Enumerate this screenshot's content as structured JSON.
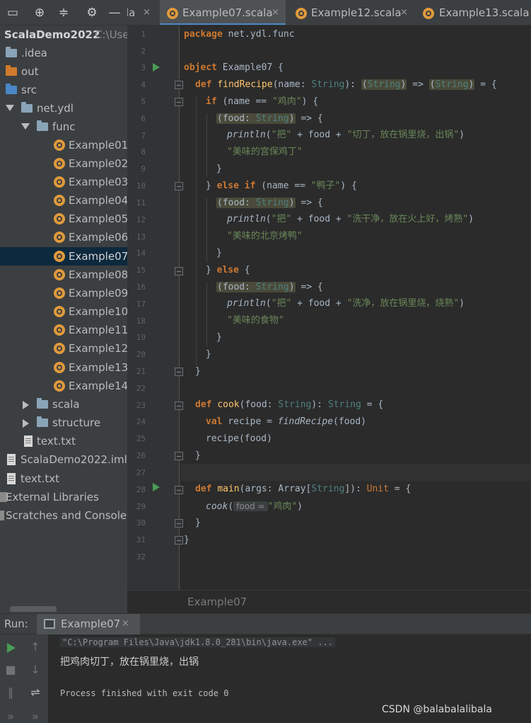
{
  "project_toolbar": {
    "icons": [
      "project-view-icon",
      "locate-icon",
      "collapse-icon",
      "gear-icon",
      "hide-icon"
    ]
  },
  "tree": {
    "root_name": "ScalaDemo2022",
    "root_path": "C:\\Use",
    "items": {
      "idea": ".idea",
      "out": "out",
      "src": "src",
      "net_ydl": "net.ydl",
      "func": "func",
      "ex01": "Example01",
      "ex02": "Example02",
      "ex03": "Example03",
      "ex04": "Example04",
      "ex05": "Example05",
      "ex06": "Example06",
      "ex07": "Example07",
      "ex08": "Example08",
      "ex09": "Example09",
      "ex10": "Example10",
      "ex11": "Example11",
      "ex12": "Example12",
      "ex13": "Example13",
      "ex14": "Example14",
      "scala": "scala",
      "structure": "structure",
      "text_inner": "text.txt",
      "iml": "ScalaDemo2022.iml",
      "text_root": "text.txt",
      "ext_libs": "External Libraries",
      "scratches": "Scratches and Consoles"
    },
    "colors": {
      "folder": "#8aa4b8",
      "excluded_folder": "#d07a2c",
      "source_folder": "#4a86c8",
      "scala": "#e09a3c"
    }
  },
  "tabs": {
    "partial": "la",
    "active": "Example07.scala",
    "t2": "Example12.scala",
    "t3": "Example13.scala",
    "close": "×"
  },
  "gutter": {
    "lines": [
      "1",
      "2",
      "3",
      "4",
      "5",
      "6",
      "7",
      "8",
      "9",
      "10",
      "11",
      "12",
      "13",
      "14",
      "15",
      "16",
      "17",
      "18",
      "19",
      "20",
      "21",
      "22",
      "23",
      "24",
      "25",
      "26",
      "27",
      "28",
      "29",
      "30",
      "31",
      "32"
    ]
  },
  "code": {
    "l1_kw": "package",
    "l1_rest": " net.ydl.func",
    "l3_kw": "object",
    "l3_rest": " Example07 {",
    "l4_kw": "def ",
    "l4_fn": "findRecipe",
    "l4_a": "(name: ",
    "l4_t1": "String",
    "l4_b": "): ",
    "l4_p1": "(",
    "l4_t2": "String",
    "l4_p2": ")",
    "l4_c": " => ",
    "l4_p3": "(",
    "l4_t3": "String",
    "l4_p4": ")",
    "l4_d": " = {",
    "l5_kw": "if",
    "l5_a": " (name == ",
    "l5_s": "\"鸡肉\"",
    "l5_b": ") {",
    "lam_a": "(food: ",
    "lam_t": "String",
    "lam_b": ")",
    "lam_c": " => {",
    "println": "println",
    "pl_s1": "\"把\"",
    "pl_plus1": " + food + ",
    "l7_s2": "\"切丁，放在锅里烧，出锅\"",
    "l7_end": ")",
    "l8_s": "\"美味的宫保鸡丁\"",
    "brace_close": "}",
    "l10_a": "} ",
    "l10_kw": "else if",
    "l10_b": " (name == ",
    "l10_s": "\"鸭子\"",
    "l10_c": ") {",
    "l12_s2": "\"洗干净，放在火上好，烤熟\"",
    "l13_s": "\"美味的北京烤鸭\"",
    "l15_a": "} ",
    "l15_kw": "else",
    "l15_b": " {",
    "l17_s2": "\"洗净，放在锅里烧，烧熟\"",
    "l18_s": "\"美味的食物\"",
    "l23_kw": "def ",
    "l23_fn": "cook",
    "l23_a": "(food: ",
    "l23_t1": "String",
    "l23_b": "): ",
    "l23_t2": "String",
    "l23_c": " = {",
    "l24_kw": "val",
    "l24_a": " recipe = ",
    "l24_fn": "findRecipe",
    "l24_b": "(food)",
    "l25": "recipe(food)",
    "l28_kw": "def ",
    "l28_fn": "main",
    "l28_a": "(args: Array[",
    "l28_t1": "String",
    "l28_b": "]): ",
    "l28_t2": "Unit",
    "l28_c": " = {",
    "l29_fn": "cook",
    "l29_a": "(",
    "l29_hint": "food =",
    "l29_s": "\"鸡肉\"",
    "l29_b": ")",
    "colors": {
      "keyword": "#cc7832",
      "type": "#4e807d",
      "function": "#ffc66d",
      "string": "#6a8759",
      "text": "#a9b7c6"
    }
  },
  "breadcrumb": "Example07",
  "run": {
    "label": "Run:",
    "tab_label": "Example07",
    "tab_close": "×",
    "icons": [
      "rerun-icon",
      "stop-icon",
      "pause-icon",
      "expand-icon",
      "up-arrow-icon",
      "down-arrow-icon",
      "soft-wrap-icon"
    ],
    "cmd": "\"C:\\Program Files\\Java\\jdk1.8.0_281\\bin\\java.exe\" ...",
    "output": "把鸡肉切丁，放在锅里烧，出锅",
    "exit": "Process finished with exit code 0"
  },
  "watermark": "CSDN @balabalalibala"
}
